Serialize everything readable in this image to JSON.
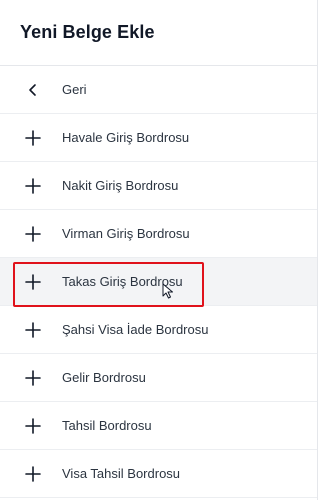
{
  "header": {
    "title": "Yeni Belge Ekle"
  },
  "menu": {
    "back": {
      "label": "Geri",
      "icon": "chevron-left-icon"
    },
    "items": [
      {
        "label": "Havale Giriş Bordrosu",
        "icon": "plus-icon"
      },
      {
        "label": "Nakit Giriş Bordrosu",
        "icon": "plus-icon"
      },
      {
        "label": "Virman Giriş Bordrosu",
        "icon": "plus-icon"
      },
      {
        "label": "Takas Giriş Bordrosu",
        "icon": "plus-icon",
        "hovered": true
      },
      {
        "label": "Şahsi Visa İade Bordrosu",
        "icon": "plus-icon"
      },
      {
        "label": "Gelir Bordrosu",
        "icon": "plus-icon"
      },
      {
        "label": "Tahsil Bordrosu",
        "icon": "plus-icon"
      },
      {
        "label": "Visa Tahsil Bordrosu",
        "icon": "plus-icon"
      }
    ]
  },
  "colors": {
    "highlight": "#e0121b",
    "hover_bg": "#f3f4f6"
  }
}
